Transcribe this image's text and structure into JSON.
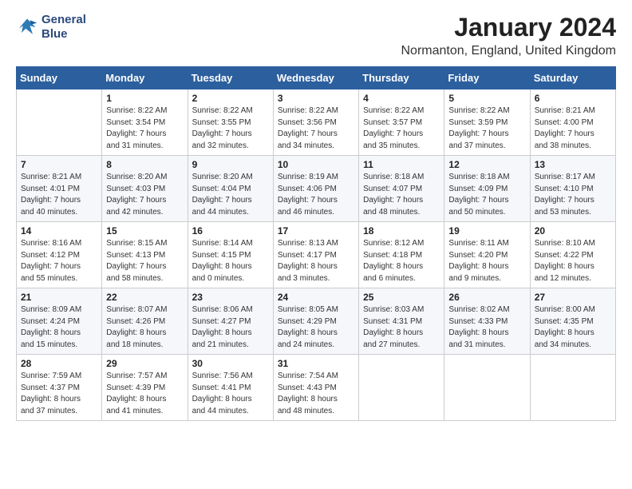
{
  "logo": {
    "line1": "General",
    "line2": "Blue"
  },
  "title": "January 2024",
  "subtitle": "Normanton, England, United Kingdom",
  "days_of_week": [
    "Sunday",
    "Monday",
    "Tuesday",
    "Wednesday",
    "Thursday",
    "Friday",
    "Saturday"
  ],
  "weeks": [
    [
      {
        "day": "",
        "info": ""
      },
      {
        "day": "1",
        "info": "Sunrise: 8:22 AM\nSunset: 3:54 PM\nDaylight: 7 hours\nand 31 minutes."
      },
      {
        "day": "2",
        "info": "Sunrise: 8:22 AM\nSunset: 3:55 PM\nDaylight: 7 hours\nand 32 minutes."
      },
      {
        "day": "3",
        "info": "Sunrise: 8:22 AM\nSunset: 3:56 PM\nDaylight: 7 hours\nand 34 minutes."
      },
      {
        "day": "4",
        "info": "Sunrise: 8:22 AM\nSunset: 3:57 PM\nDaylight: 7 hours\nand 35 minutes."
      },
      {
        "day": "5",
        "info": "Sunrise: 8:22 AM\nSunset: 3:59 PM\nDaylight: 7 hours\nand 37 minutes."
      },
      {
        "day": "6",
        "info": "Sunrise: 8:21 AM\nSunset: 4:00 PM\nDaylight: 7 hours\nand 38 minutes."
      }
    ],
    [
      {
        "day": "7",
        "info": "Sunrise: 8:21 AM\nSunset: 4:01 PM\nDaylight: 7 hours\nand 40 minutes."
      },
      {
        "day": "8",
        "info": "Sunrise: 8:20 AM\nSunset: 4:03 PM\nDaylight: 7 hours\nand 42 minutes."
      },
      {
        "day": "9",
        "info": "Sunrise: 8:20 AM\nSunset: 4:04 PM\nDaylight: 7 hours\nand 44 minutes."
      },
      {
        "day": "10",
        "info": "Sunrise: 8:19 AM\nSunset: 4:06 PM\nDaylight: 7 hours\nand 46 minutes."
      },
      {
        "day": "11",
        "info": "Sunrise: 8:18 AM\nSunset: 4:07 PM\nDaylight: 7 hours\nand 48 minutes."
      },
      {
        "day": "12",
        "info": "Sunrise: 8:18 AM\nSunset: 4:09 PM\nDaylight: 7 hours\nand 50 minutes."
      },
      {
        "day": "13",
        "info": "Sunrise: 8:17 AM\nSunset: 4:10 PM\nDaylight: 7 hours\nand 53 minutes."
      }
    ],
    [
      {
        "day": "14",
        "info": "Sunrise: 8:16 AM\nSunset: 4:12 PM\nDaylight: 7 hours\nand 55 minutes."
      },
      {
        "day": "15",
        "info": "Sunrise: 8:15 AM\nSunset: 4:13 PM\nDaylight: 7 hours\nand 58 minutes."
      },
      {
        "day": "16",
        "info": "Sunrise: 8:14 AM\nSunset: 4:15 PM\nDaylight: 8 hours\nand 0 minutes."
      },
      {
        "day": "17",
        "info": "Sunrise: 8:13 AM\nSunset: 4:17 PM\nDaylight: 8 hours\nand 3 minutes."
      },
      {
        "day": "18",
        "info": "Sunrise: 8:12 AM\nSunset: 4:18 PM\nDaylight: 8 hours\nand 6 minutes."
      },
      {
        "day": "19",
        "info": "Sunrise: 8:11 AM\nSunset: 4:20 PM\nDaylight: 8 hours\nand 9 minutes."
      },
      {
        "day": "20",
        "info": "Sunrise: 8:10 AM\nSunset: 4:22 PM\nDaylight: 8 hours\nand 12 minutes."
      }
    ],
    [
      {
        "day": "21",
        "info": "Sunrise: 8:09 AM\nSunset: 4:24 PM\nDaylight: 8 hours\nand 15 minutes."
      },
      {
        "day": "22",
        "info": "Sunrise: 8:07 AM\nSunset: 4:26 PM\nDaylight: 8 hours\nand 18 minutes."
      },
      {
        "day": "23",
        "info": "Sunrise: 8:06 AM\nSunset: 4:27 PM\nDaylight: 8 hours\nand 21 minutes."
      },
      {
        "day": "24",
        "info": "Sunrise: 8:05 AM\nSunset: 4:29 PM\nDaylight: 8 hours\nand 24 minutes."
      },
      {
        "day": "25",
        "info": "Sunrise: 8:03 AM\nSunset: 4:31 PM\nDaylight: 8 hours\nand 27 minutes."
      },
      {
        "day": "26",
        "info": "Sunrise: 8:02 AM\nSunset: 4:33 PM\nDaylight: 8 hours\nand 31 minutes."
      },
      {
        "day": "27",
        "info": "Sunrise: 8:00 AM\nSunset: 4:35 PM\nDaylight: 8 hours\nand 34 minutes."
      }
    ],
    [
      {
        "day": "28",
        "info": "Sunrise: 7:59 AM\nSunset: 4:37 PM\nDaylight: 8 hours\nand 37 minutes."
      },
      {
        "day": "29",
        "info": "Sunrise: 7:57 AM\nSunset: 4:39 PM\nDaylight: 8 hours\nand 41 minutes."
      },
      {
        "day": "30",
        "info": "Sunrise: 7:56 AM\nSunset: 4:41 PM\nDaylight: 8 hours\nand 44 minutes."
      },
      {
        "day": "31",
        "info": "Sunrise: 7:54 AM\nSunset: 4:43 PM\nDaylight: 8 hours\nand 48 minutes."
      },
      {
        "day": "",
        "info": ""
      },
      {
        "day": "",
        "info": ""
      },
      {
        "day": "",
        "info": ""
      }
    ]
  ]
}
